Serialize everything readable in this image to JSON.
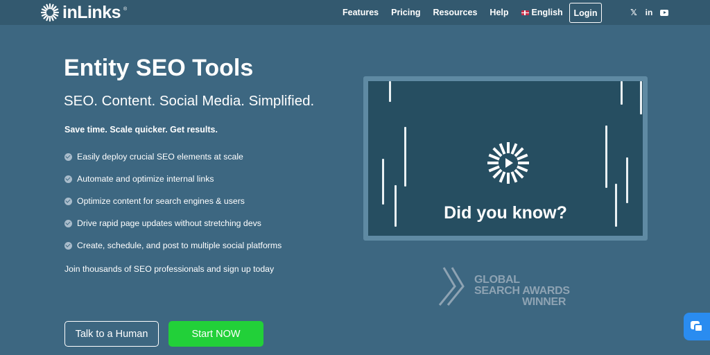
{
  "nav": {
    "logo_text": "inLinks",
    "logo_reg": "®",
    "links": [
      "Features",
      "Pricing",
      "Resources",
      "Help"
    ],
    "language": "English",
    "login": "Login",
    "social_icons": [
      "x-icon",
      "linkedin-icon",
      "youtube-icon"
    ],
    "x_glyph": "𝕏",
    "linkedin_glyph": "in"
  },
  "hero": {
    "title": "Entity SEO Tools",
    "subtitle": "SEO. Content. Social Media. Simplified.",
    "tagline": "Save time. Scale quicker. Get results.",
    "features": [
      "Easily deploy crucial SEO elements at scale",
      "Automate and optimize internal links",
      "Optimize content for search engines & users",
      "Drive rapid page updates without stretching devs",
      "Create, schedule, and post to multiple social platforms"
    ],
    "join_text": "Join thousands of SEO professionals and sign up today",
    "cta_secondary": "Talk to a Human",
    "cta_primary": "Start NOW"
  },
  "video": {
    "caption": "Did you know?"
  },
  "award": {
    "line1": "GLOBAL",
    "line2": "SEARCH AWARDS",
    "line3": "WINNER"
  },
  "colors": {
    "background": "#3d6781",
    "nav_background": "#33596f",
    "primary_button": "#22d039",
    "chat_button": "#2a8cf0"
  }
}
